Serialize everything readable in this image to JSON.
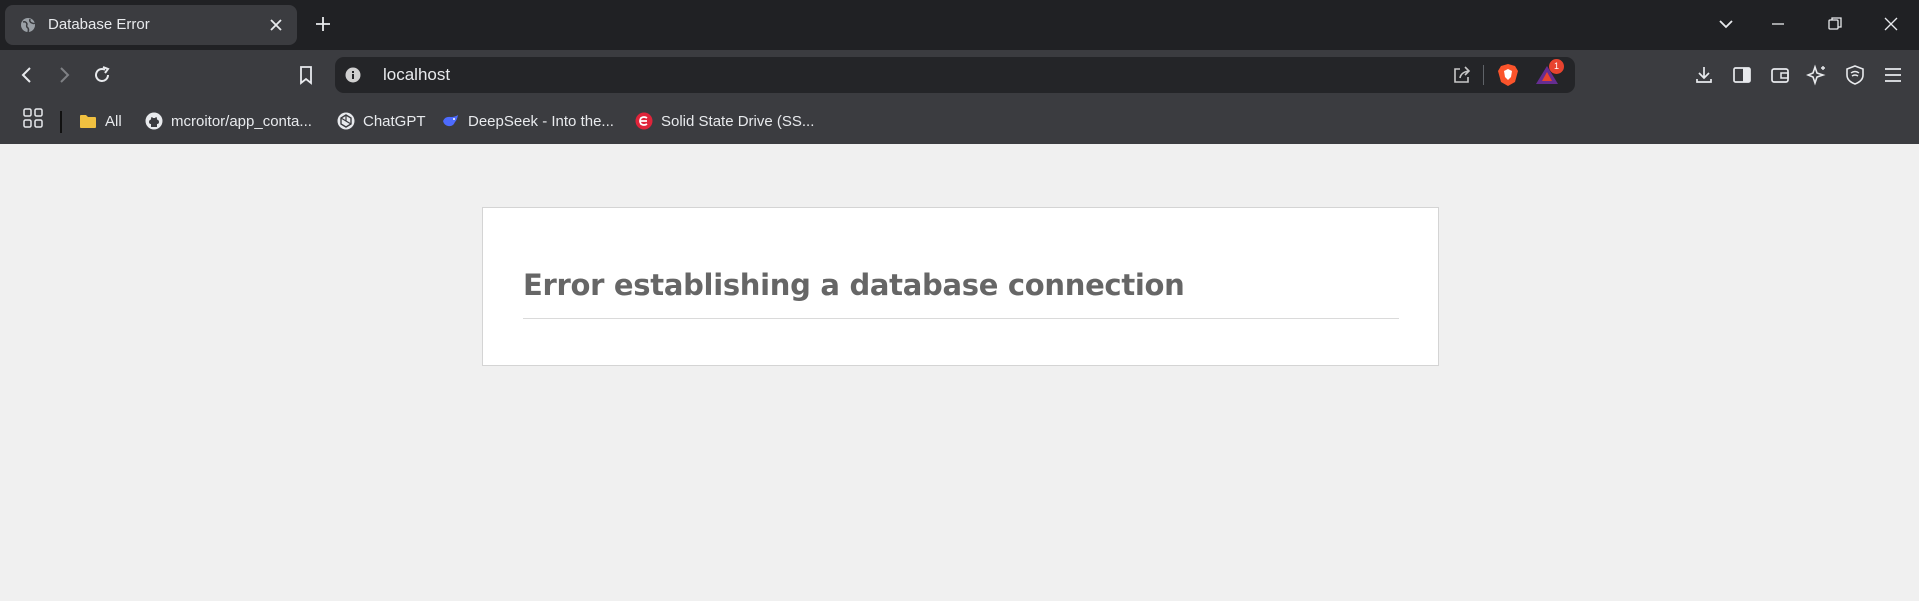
{
  "browser": {
    "tab": {
      "title": "Database Error",
      "favicon": "globe-icon",
      "close_icon": "close-icon"
    },
    "new_tab_icon": "plus-icon",
    "window_controls": [
      "tab-search-icon",
      "minimize-icon",
      "restore-icon",
      "close-window-icon"
    ],
    "toolbar": {
      "url": "localhost",
      "notification_count": "1"
    },
    "bookmarks": [
      {
        "label": "All",
        "icon": "folder-icon"
      },
      {
        "label": "mcroitor/app_conta...",
        "icon": "github-icon"
      },
      {
        "label": "ChatGPT",
        "icon": "chatgpt-icon"
      },
      {
        "label": "DeepSeek - Into the...",
        "icon": "deepseek-icon"
      },
      {
        "label": "Solid State Drive (SS...",
        "icon": "ssd-icon"
      }
    ]
  },
  "page": {
    "error_title": "Error establishing a database connection"
  },
  "colors": {
    "accent_brave": "#fb542b",
    "page_background": "#f0f0f0",
    "title_color": "#666666"
  }
}
